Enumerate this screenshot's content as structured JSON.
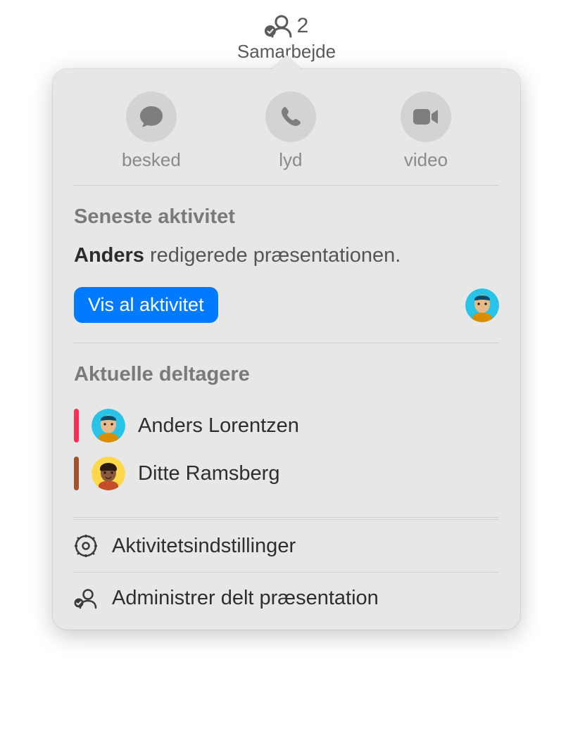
{
  "toolbar": {
    "count": "2",
    "label": "Samarbejde"
  },
  "popover": {
    "communication": {
      "message_label": "besked",
      "audio_label": "lyd",
      "video_label": "video"
    },
    "recent_activity": {
      "title": "Seneste aktivitet",
      "actor": "Anders",
      "action_text": " redigerede præsentationen.",
      "show_all_button": "Vis al aktivitet"
    },
    "participants": {
      "title": "Aktuelle deltagere",
      "list": [
        {
          "name": "Anders Lorentzen",
          "presence_color": "#ff2d55",
          "avatar_bg": "#28c3e6",
          "avatar_body": "#d98e00"
        },
        {
          "name": "Ditte Ramsberg",
          "presence_color": "#a0522d",
          "avatar_bg": "#ffd74a",
          "avatar_body": "#8a5a3c"
        }
      ]
    },
    "settings": {
      "activity_settings_label": "Aktivitetsindstillinger",
      "manage_shared_label": "Administrer delt præsentation"
    }
  }
}
